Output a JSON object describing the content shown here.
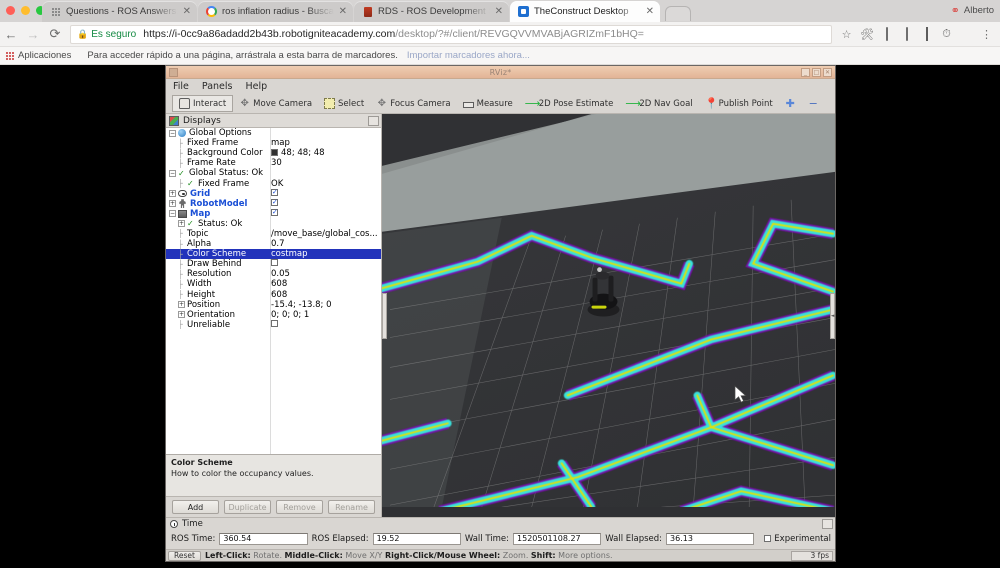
{
  "browser": {
    "tabs": [
      {
        "title": "Questions - ROS Answers: Op",
        "favicon": "dots-icon",
        "active": false,
        "close": "✕"
      },
      {
        "title": "ros inflation radius - Buscar co",
        "favicon": "google-icon",
        "active": false,
        "close": "✕"
      },
      {
        "title": "RDS - ROS Development Stud",
        "favicon": "rds-icon",
        "active": false,
        "close": "✕"
      },
      {
        "title": "TheConstruct Desktop",
        "favicon": "theconstruct-icon",
        "active": true,
        "close": "✕"
      }
    ],
    "profile_name": "Alberto",
    "nav": {
      "back": "←",
      "forward": "→",
      "reload": "⟳"
    },
    "omnibox": {
      "lock_icon": "lock-icon",
      "secure_label": "Es seguro",
      "url_main": "https://i-0cc9a86adadd2b43b.robotigniteacademy.com",
      "url_path": "/desktop/?#/client/REVGQVVMVABjAGRIZmF1bHQ="
    },
    "toolbar_icons": [
      "star-icon",
      "extension-icon",
      "off-badge-icon",
      "window-icon",
      "film-icon",
      "clock-icon",
      "record-icon",
      "menu-icon"
    ],
    "bookmarks": {
      "apps_label": "Aplicaciones",
      "hint": "Para acceder rápido a una página, arrástrala a esta barra de marcadores.",
      "import_link": "Importar marcadores ahora..."
    }
  },
  "rviz": {
    "window_title": "RViz*",
    "window_buttons": [
      "_",
      "□",
      "✕"
    ],
    "menu": [
      "File",
      "Panels",
      "Help"
    ],
    "toolbar": [
      {
        "label": "Interact",
        "icon": "interact-icon",
        "selected": true
      },
      {
        "label": "Move Camera",
        "icon": "move-camera-icon",
        "selected": false
      },
      {
        "label": "Select",
        "icon": "select-icon",
        "selected": false
      },
      {
        "label": "Focus Camera",
        "icon": "focus-camera-icon",
        "selected": false
      },
      {
        "label": "Measure",
        "icon": "measure-icon",
        "selected": false
      },
      {
        "label": "2D Pose Estimate",
        "icon": "pose-estimate-icon",
        "selected": false
      },
      {
        "label": "2D Nav Goal",
        "icon": "nav-goal-icon",
        "selected": false
      },
      {
        "label": "Publish Point",
        "icon": "publish-point-icon",
        "selected": false
      },
      {
        "label": "",
        "icon": "add-tool-icon",
        "selected": false
      },
      {
        "label": "",
        "icon": "remove-tool-icon",
        "selected": false
      }
    ],
    "displays": {
      "panel_title": "Displays",
      "rows": [
        {
          "indent": 0,
          "expander": "−",
          "icon": "globe-icon",
          "name": "Global Options",
          "value": "",
          "style": "plain"
        },
        {
          "indent": 1,
          "expander": "dash",
          "icon": "none",
          "name": "Fixed Frame",
          "value": "map",
          "style": "plain"
        },
        {
          "indent": 1,
          "expander": "dash",
          "icon": "none",
          "name": "Background Color",
          "value": "48; 48; 48",
          "style": "color",
          "swatch": "#303030"
        },
        {
          "indent": 1,
          "expander": "dash",
          "icon": "none",
          "name": "Frame Rate",
          "value": "30",
          "style": "plain"
        },
        {
          "indent": 0,
          "expander": "−",
          "icon": "check-icon",
          "name": "Global Status: Ok",
          "value": "",
          "style": "plain"
        },
        {
          "indent": 1,
          "expander": "dash",
          "icon": "check-icon",
          "name": "Fixed Frame",
          "value": "OK",
          "style": "plain"
        },
        {
          "indent": 0,
          "expander": "+",
          "icon": "eye-icon",
          "name": "Grid",
          "value": "",
          "style": "blue",
          "checkbox": true
        },
        {
          "indent": 0,
          "expander": "+",
          "icon": "robot-icon",
          "name": "RobotModel",
          "value": "",
          "style": "blue",
          "checkbox": true
        },
        {
          "indent": 0,
          "expander": "−",
          "icon": "map-icon",
          "name": "Map",
          "value": "",
          "style": "blue",
          "checkbox": true
        },
        {
          "indent": 1,
          "expander": "+",
          "icon": "check-icon",
          "name": "Status: Ok",
          "value": "",
          "style": "plain"
        },
        {
          "indent": 1,
          "expander": "dash",
          "icon": "none",
          "name": "Topic",
          "value": "/move_base/global_cos...",
          "style": "plain"
        },
        {
          "indent": 1,
          "expander": "dash",
          "icon": "none",
          "name": "Alpha",
          "value": "0.7",
          "style": "plain"
        },
        {
          "indent": 1,
          "expander": "dash",
          "icon": "none",
          "name": "Color Scheme",
          "value": "costmap",
          "style": "selected"
        },
        {
          "indent": 1,
          "expander": "dash",
          "icon": "none",
          "name": "Draw Behind",
          "value": "",
          "style": "plain",
          "valuecheckbox": false
        },
        {
          "indent": 1,
          "expander": "dash",
          "icon": "none",
          "name": "Resolution",
          "value": "0.05",
          "style": "plain"
        },
        {
          "indent": 1,
          "expander": "dash",
          "icon": "none",
          "name": "Width",
          "value": "608",
          "style": "plain"
        },
        {
          "indent": 1,
          "expander": "dash",
          "icon": "none",
          "name": "Height",
          "value": "608",
          "style": "plain"
        },
        {
          "indent": 1,
          "expander": "+",
          "icon": "none",
          "name": "Position",
          "value": "-15.4; -13.8; 0",
          "style": "plain"
        },
        {
          "indent": 1,
          "expander": "+",
          "icon": "none",
          "name": "Orientation",
          "value": "0; 0; 0; 1",
          "style": "plain"
        },
        {
          "indent": 1,
          "expander": "dash",
          "icon": "none",
          "name": "Unreliable",
          "value": "",
          "style": "plain",
          "valuecheckbox": false
        }
      ],
      "help": {
        "title": "Color Scheme",
        "text": "How to color the occupancy values."
      },
      "buttons": [
        {
          "label": "Add",
          "enabled": true
        },
        {
          "label": "Duplicate",
          "enabled": false
        },
        {
          "label": "Remove",
          "enabled": false
        },
        {
          "label": "Rename",
          "enabled": false
        }
      ]
    },
    "time_panel": {
      "title": "Time",
      "fields": [
        {
          "label": "ROS Time:",
          "value": "360.54"
        },
        {
          "label": "ROS Elapsed:",
          "value": "19.52"
        },
        {
          "label": "Wall Time:",
          "value": "1520501108.27"
        },
        {
          "label": "Wall Elapsed:",
          "value": "36.13"
        }
      ],
      "experimental_label": "Experimental",
      "experimental_checked": false
    },
    "status_bar": {
      "reset_label": "Reset",
      "hints": [
        {
          "bold": "Left-Click:",
          "text": " Rotate. "
        },
        {
          "bold": "Middle-Click:",
          "text": " Move X/Y "
        },
        {
          "bold": "Right-Click/Mouse Wheel:",
          "text": " Zoom. "
        },
        {
          "bold": "Shift:",
          "text": " More options."
        }
      ],
      "fps": "3 fps"
    },
    "viewport": {
      "background_color": "#2f3033",
      "grid_color": "#9a9a9a",
      "costmap_inflation_color": "#38e0dc",
      "costmap_lethal_color": "#e8e000",
      "costmap_edge_color": "#7a0fb0",
      "robot_label": "turtlebot-robot",
      "cursor_label": "mouse-cursor"
    }
  }
}
